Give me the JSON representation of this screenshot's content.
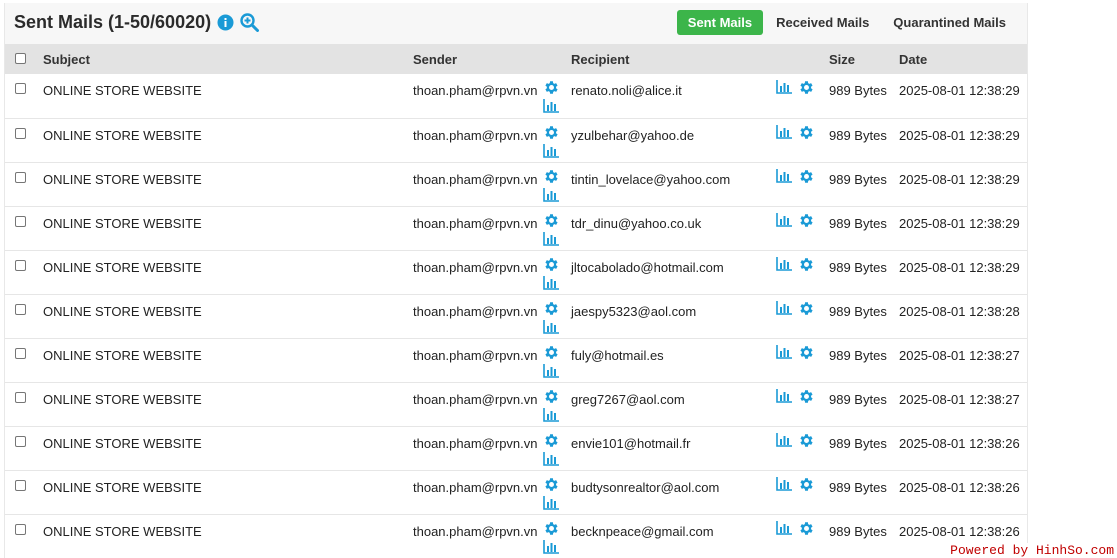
{
  "header": {
    "title": "Sent Mails (1-50/60020)",
    "info_icon": "info-circle-icon",
    "zoom_icon": "zoom-in-icon"
  },
  "tabs": [
    {
      "label": "Sent Mails",
      "active": true
    },
    {
      "label": "Received Mails",
      "active": false
    },
    {
      "label": "Quarantined Mails",
      "active": false
    }
  ],
  "columns": {
    "subject": "Subject",
    "sender": "Sender",
    "recipient": "Recipient",
    "size": "Size",
    "date": "Date"
  },
  "rows": [
    {
      "subject": "ONLINE STORE WEBSITE",
      "sender": "thoan.pham@rpvn.vn",
      "recipient": "renato.noli@alice.it",
      "size": "989 Bytes",
      "date": "2025-08-01 12:38:29"
    },
    {
      "subject": "ONLINE STORE WEBSITE",
      "sender": "thoan.pham@rpvn.vn",
      "recipient": "yzulbehar@yahoo.de",
      "size": "989 Bytes",
      "date": "2025-08-01 12:38:29"
    },
    {
      "subject": "ONLINE STORE WEBSITE",
      "sender": "thoan.pham@rpvn.vn",
      "recipient": "tintin_lovelace@yahoo.com",
      "size": "989 Bytes",
      "date": "2025-08-01 12:38:29"
    },
    {
      "subject": "ONLINE STORE WEBSITE",
      "sender": "thoan.pham@rpvn.vn",
      "recipient": "tdr_dinu@yahoo.co.uk",
      "size": "989 Bytes",
      "date": "2025-08-01 12:38:29"
    },
    {
      "subject": "ONLINE STORE WEBSITE",
      "sender": "thoan.pham@rpvn.vn",
      "recipient": "jltocabolado@hotmail.com",
      "size": "989 Bytes",
      "date": "2025-08-01 12:38:29"
    },
    {
      "subject": "ONLINE STORE WEBSITE",
      "sender": "thoan.pham@rpvn.vn",
      "recipient": "jaespy5323@aol.com",
      "size": "989 Bytes",
      "date": "2025-08-01 12:38:28"
    },
    {
      "subject": "ONLINE STORE WEBSITE",
      "sender": "thoan.pham@rpvn.vn",
      "recipient": "fuly@hotmail.es",
      "size": "989 Bytes",
      "date": "2025-08-01 12:38:27"
    },
    {
      "subject": "ONLINE STORE WEBSITE",
      "sender": "thoan.pham@rpvn.vn",
      "recipient": "greg7267@aol.com",
      "size": "989 Bytes",
      "date": "2025-08-01 12:38:27"
    },
    {
      "subject": "ONLINE STORE WEBSITE",
      "sender": "thoan.pham@rpvn.vn",
      "recipient": "envie101@hotmail.fr",
      "size": "989 Bytes",
      "date": "2025-08-01 12:38:26"
    },
    {
      "subject": "ONLINE STORE WEBSITE",
      "sender": "thoan.pham@rpvn.vn",
      "recipient": "budtysonrealtor@aol.com",
      "size": "989 Bytes",
      "date": "2025-08-01 12:38:26"
    },
    {
      "subject": "ONLINE STORE WEBSITE",
      "sender": "thoan.pham@rpvn.vn",
      "recipient": "becknpeace@gmail.com",
      "size": "989 Bytes",
      "date": "2025-08-01 12:38:26"
    }
  ],
  "row_icons": {
    "gear": "gear-icon",
    "stats": "bar-chart-icon"
  },
  "footer": {
    "powered": "Powered by HinhSo.com"
  },
  "colors": {
    "accent": "#1a9ad6",
    "active_tab": "#3cb54a",
    "powered": "#c00000"
  }
}
